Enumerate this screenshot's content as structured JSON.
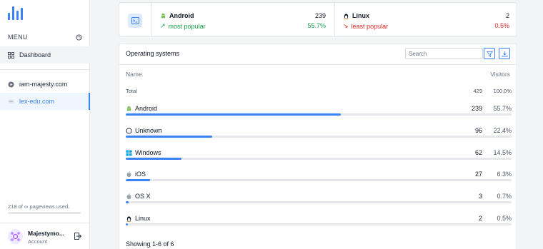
{
  "sidebar": {
    "menu_label": "MENU",
    "nav": [
      {
        "label": "Dashboard"
      },
      {
        "label": "iam-majesty.com"
      },
      {
        "label": "lex-edu.com"
      }
    ],
    "usage_text": "218 of ∞ pageviews used.",
    "usage_fraction": 0.0,
    "account": {
      "name": "Majestymo...",
      "sub": "Account"
    }
  },
  "summary": {
    "top": {
      "name": "Android",
      "count": "239",
      "note": "most popular",
      "pct": "55.7%"
    },
    "bottom": {
      "name": "Linux",
      "count": "2",
      "note": "least popular",
      "pct": "0.5%"
    }
  },
  "panel": {
    "title": "Operating systems",
    "search_placeholder": "Search",
    "col_name": "Name",
    "col_visitors": "Visitors",
    "total": {
      "label": "Total",
      "count": "429",
      "pct": "100.0%"
    },
    "rows": [
      {
        "name": "Android",
        "count": "239",
        "pct": "55.7%",
        "fraction": 0.557,
        "icon": "android-icon"
      },
      {
        "name": "Unknown",
        "count": "96",
        "pct": "22.4%",
        "fraction": 0.224,
        "icon": "circle-icon"
      },
      {
        "name": "Windows",
        "count": "62",
        "pct": "14.5%",
        "fraction": 0.145,
        "icon": "windows-icon"
      },
      {
        "name": "iOS",
        "count": "27",
        "pct": "6.3%",
        "fraction": 0.063,
        "icon": "apple-icon"
      },
      {
        "name": "OS X",
        "count": "3",
        "pct": "0.7%",
        "fraction": 0.007,
        "icon": "apple-icon"
      },
      {
        "name": "Linux",
        "count": "2",
        "pct": "0.5%",
        "fraction": 0.005,
        "icon": "linux-icon"
      }
    ],
    "footer": "Showing 1-6 of 6"
  },
  "colors": {
    "accent": "#3b82f6",
    "positive": "#16a34a",
    "negative": "#dc2626"
  }
}
